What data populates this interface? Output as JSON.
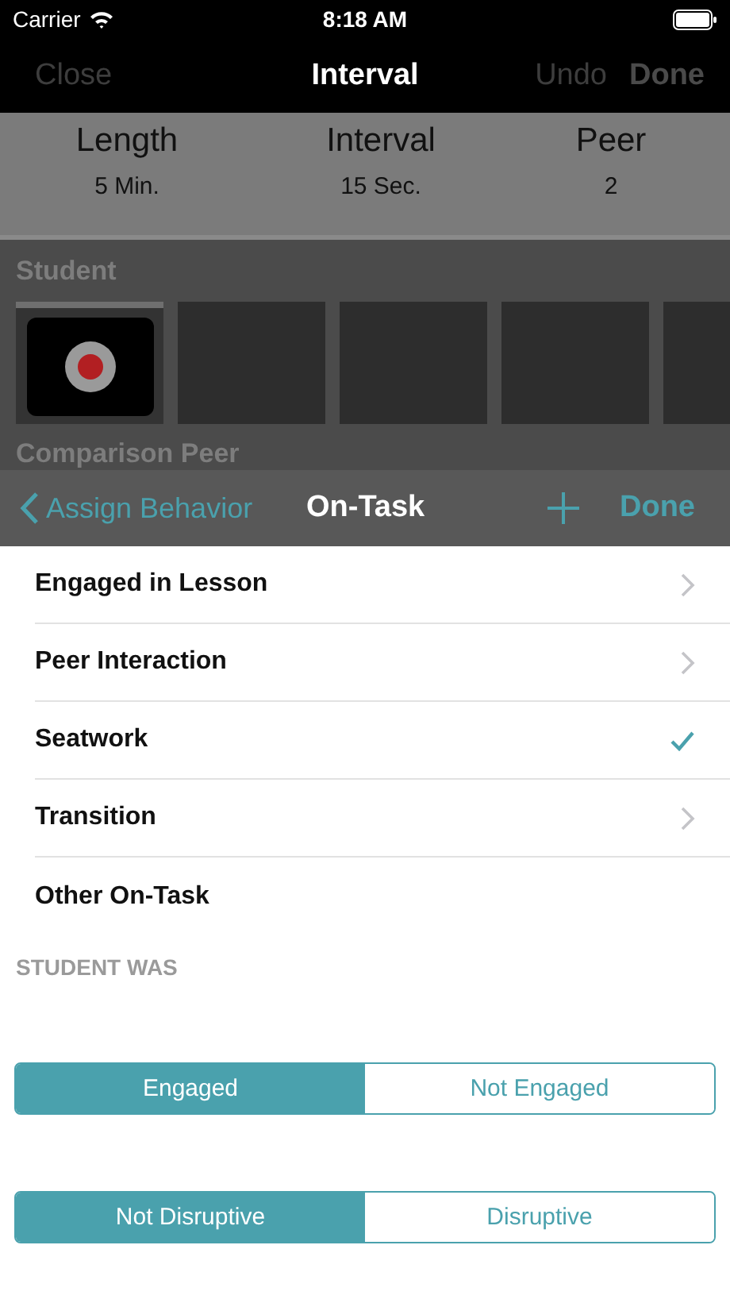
{
  "status_bar": {
    "carrier": "Carrier",
    "time": "8:18 AM"
  },
  "nav_bar": {
    "title": "Interval",
    "left": [
      {
        "label": "Close",
        "disabled": true
      }
    ],
    "right": [
      {
        "label": "Undo",
        "disabled": true
      },
      {
        "label": "Done",
        "disabled": true
      }
    ]
  },
  "stats": [
    {
      "label": "Length",
      "value": "5 Min."
    },
    {
      "label": "Interval",
      "value": "15 Sec."
    },
    {
      "label": "Peer",
      "value": "2"
    }
  ],
  "student": {
    "heading": "Student",
    "tiles": [
      {
        "kind": "record",
        "selected": true
      },
      {
        "kind": "empty",
        "selected": false
      },
      {
        "kind": "empty",
        "selected": false
      },
      {
        "kind": "empty",
        "selected": false
      },
      {
        "kind": "empty",
        "selected": false
      }
    ]
  },
  "comparison_heading": "Comparison Peer",
  "sheet": {
    "back": "Assign Behavior",
    "title": "On-Task",
    "done": "Done",
    "items": [
      {
        "label": "Engaged in Lesson",
        "kind": "submenu"
      },
      {
        "label": "Peer Interaction",
        "kind": "submenu"
      },
      {
        "label": "Seatwork",
        "kind": "option",
        "selected": true
      },
      {
        "label": "Transition",
        "kind": "submenu"
      },
      {
        "label": "Other On-Task",
        "kind": "option",
        "selected": false
      }
    ],
    "section_header": "STUDENT WAS",
    "segments": [
      {
        "options": [
          {
            "label": "Engaged",
            "selected": true
          },
          {
            "label": "Not Engaged",
            "selected": false
          }
        ]
      },
      {
        "options": [
          {
            "label": "Not Disruptive",
            "selected": true
          },
          {
            "label": "Disruptive",
            "selected": false
          }
        ]
      }
    ]
  }
}
